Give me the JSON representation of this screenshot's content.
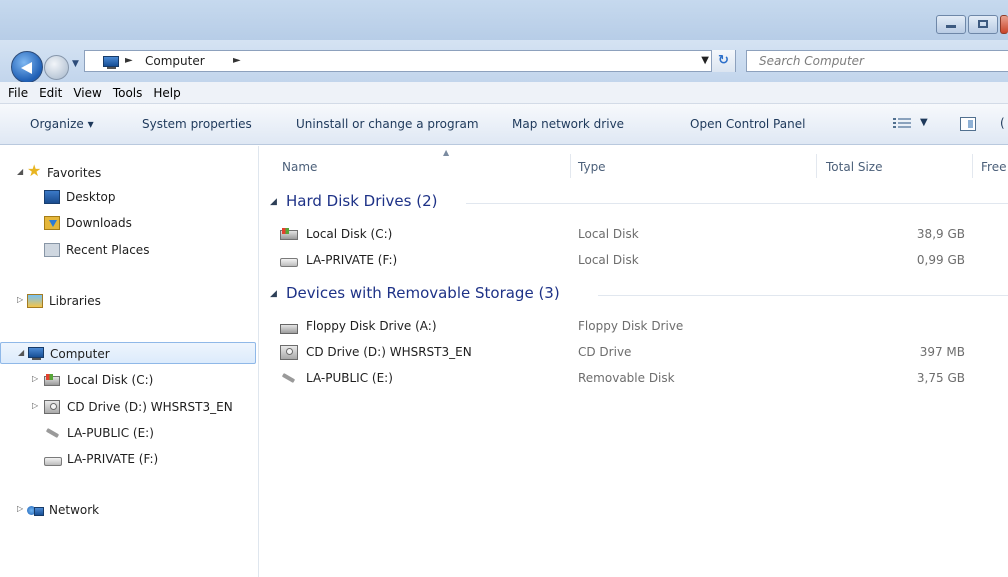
{
  "navigation": {
    "breadcrumb_root_icon": "computer-icon",
    "breadcrumb_item": "Computer",
    "search_placeholder": "Search Computer"
  },
  "menu": [
    "File",
    "Edit",
    "View",
    "Tools",
    "Help"
  ],
  "commands": {
    "organize": "Organize ▾",
    "system_properties": "System properties",
    "uninstall": "Uninstall or change a program",
    "map_drive": "Map network drive",
    "control_panel": "Open Control Panel",
    "help_partial": "("
  },
  "sidebar": {
    "favorites": {
      "label": "Favorites",
      "icon": "star-icon"
    },
    "favorites_items": [
      {
        "label": "Desktop",
        "icon": "desktop-icon"
      },
      {
        "label": "Downloads",
        "icon": "downloads-icon"
      },
      {
        "label": "Recent Places",
        "icon": "recent-places-icon"
      }
    ],
    "libraries": {
      "label": "Libraries",
      "icon": "libraries-icon"
    },
    "computer": {
      "label": "Computer",
      "icon": "computer-icon"
    },
    "computer_items": [
      {
        "label": "Local Disk (C:)",
        "icon": "local-disk-icon"
      },
      {
        "label": "CD Drive (D:) WHSRST3_EN",
        "icon": "cd-drive-icon"
      },
      {
        "label": "LA-PUBLIC (E:)",
        "icon": "usb-drive-icon"
      },
      {
        "label": "LA-PRIVATE (F:)",
        "icon": "drive-icon"
      }
    ],
    "network": {
      "label": "Network",
      "icon": "network-icon"
    }
  },
  "columns": {
    "name": "Name",
    "type": "Type",
    "total_size": "Total Size",
    "free_partial": "Free"
  },
  "groups": [
    {
      "label": "Hard Disk Drives (2)",
      "items": [
        {
          "name": "Local Disk (C:)",
          "type": "Local Disk",
          "size": "38,9 GB",
          "icon": "local-disk-icon"
        },
        {
          "name": "LA-PRIVATE (F:)",
          "type": "Local Disk",
          "size": "0,99 GB",
          "icon": "drive-icon"
        }
      ]
    },
    {
      "label": "Devices with Removable Storage (3)",
      "items": [
        {
          "name": "Floppy Disk Drive (A:)",
          "type": "Floppy Disk Drive",
          "size": "",
          "icon": "floppy-drive-icon"
        },
        {
          "name": "CD Drive (D:) WHSRST3_EN",
          "type": "CD Drive",
          "size": "397 MB",
          "icon": "cd-drive-icon"
        },
        {
          "name": "LA-PUBLIC (E:)",
          "type": "Removable Disk",
          "size": "3,75 GB",
          "icon": "usb-drive-icon"
        }
      ]
    }
  ],
  "colors": {
    "group_header": "#1e3287",
    "selection_border": "#8fb8e8",
    "chrome": "#c6d9ee"
  }
}
